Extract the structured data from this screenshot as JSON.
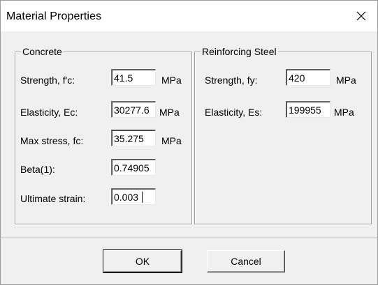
{
  "window": {
    "title": "Material Properties",
    "close_glyph": "✕"
  },
  "concrete": {
    "legend": "Concrete",
    "fields": [
      {
        "label": "Strength, f'c:",
        "value": "41.5",
        "unit": "MPa"
      },
      {
        "label": "Elasticity, Ec:",
        "value": "30277.6",
        "unit": "MPa"
      },
      {
        "label": "Max stress, fc:",
        "value": "35.275",
        "unit": "MPa"
      },
      {
        "label": "Beta(1):",
        "value": "0.74905",
        "unit": ""
      },
      {
        "label": "Ultimate strain:",
        "value": "0.003",
        "unit": ""
      }
    ]
  },
  "steel": {
    "legend": "Reinforcing Steel",
    "fields": [
      {
        "label": "Strength, fy:",
        "value": "420",
        "unit": "MPa"
      },
      {
        "label": "Elasticity, Es:",
        "value": "199955",
        "unit": "MPa"
      }
    ]
  },
  "buttons": {
    "ok": "OK",
    "cancel": "Cancel"
  }
}
